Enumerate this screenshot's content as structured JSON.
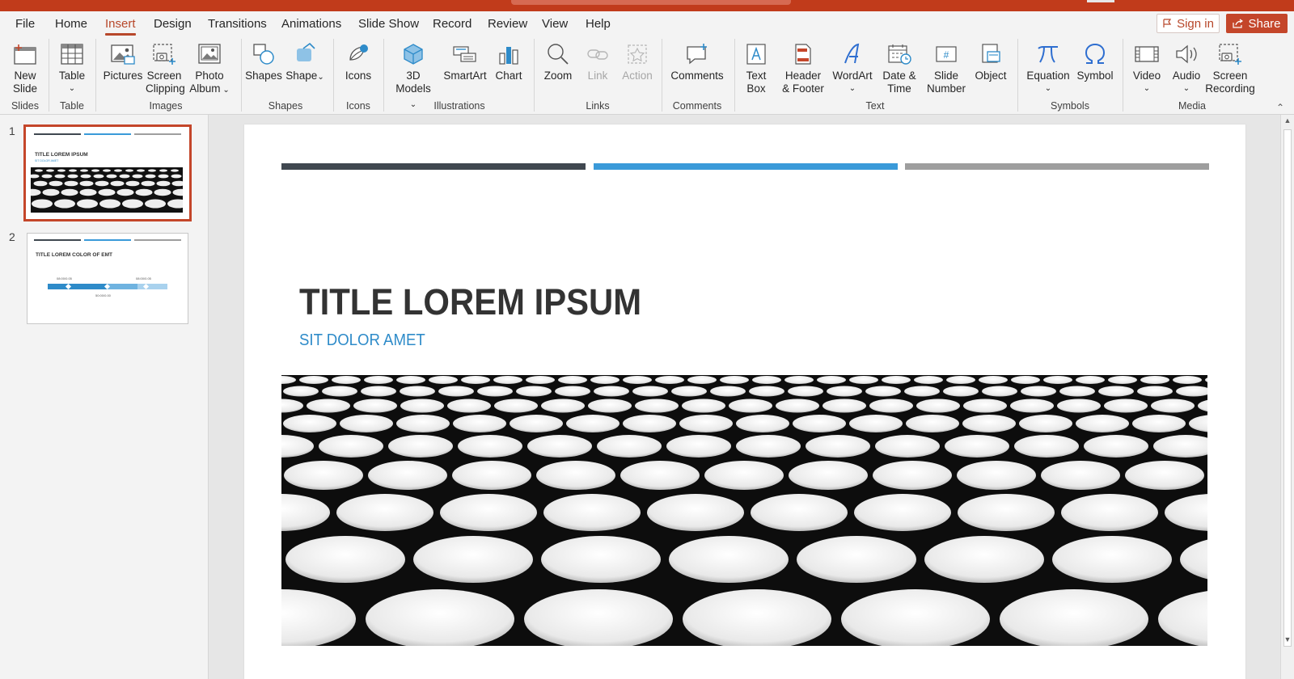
{
  "menu": {
    "tabs": [
      "File",
      "Home",
      "Insert",
      "Design",
      "Transitions",
      "Animations",
      "Slide Show",
      "Record",
      "Review",
      "View",
      "Help"
    ],
    "active": "Insert",
    "sign_in": "Sign in",
    "share": "Share"
  },
  "ribbon": {
    "new_slide": [
      "New",
      "Slide"
    ],
    "table": "Table",
    "pictures": "Pictures",
    "screen_clipping": [
      "Screen",
      "Clipping"
    ],
    "photo_album": [
      "Photo",
      "Album"
    ],
    "shapes": "Shapes",
    "shape_menu": "Shape",
    "icons": "Icons",
    "models_3d": [
      "3D",
      "Models"
    ],
    "smartart": "SmartArt",
    "chart": "Chart",
    "zoom": "Zoom",
    "link": "Link",
    "action": "Action",
    "comments": "Comments",
    "text_box": [
      "Text",
      "Box"
    ],
    "header_footer": [
      "Header",
      "& Footer"
    ],
    "wordart": "WordArt",
    "date_time": [
      "Date &",
      "Time"
    ],
    "slide_number": [
      "Slide",
      "Number"
    ],
    "object": "Object",
    "equation": "Equation",
    "symbol": "Symbol",
    "video": "Video",
    "audio": "Audio",
    "screen_recording": [
      "Screen",
      "Recording"
    ],
    "groups": {
      "slides": "Slides",
      "table": "Table",
      "images": "Images",
      "shapes": "Shapes",
      "icons": "Icons",
      "illustrations": "Illustrations",
      "links": "Links",
      "comments": "Comments",
      "text": "Text",
      "symbols": "Symbols",
      "media": "Media"
    }
  },
  "thumbnails": [
    {
      "number": "1",
      "title": "TITLE LOREM IPSUM",
      "subtitle": "SIT DOLOR AMET"
    },
    {
      "number": "2",
      "title": "TITLE LOREM COLOR OF EMT",
      "labels": [
        "08:00/0.05",
        "08:00/0.05",
        "50:00/0.00"
      ]
    }
  ],
  "slide": {
    "title": "TITLE LOREM IPSUM",
    "subtitle": "SIT DOLOR AMET"
  },
  "colors": {
    "accent": "#c4462a",
    "bar_dark": "#404850",
    "bar_blue": "#3a9ad9",
    "bar_gray": "#9e9e9e",
    "subtitle_blue": "#2e8bc9"
  }
}
